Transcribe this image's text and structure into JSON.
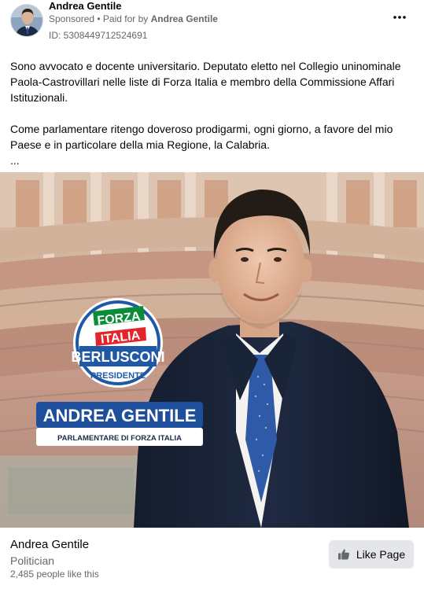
{
  "post": {
    "page_name": "Andrea Gentile",
    "sponsored_label": "Sponsored",
    "separator": " • ",
    "paid_for_prefix": "Paid for by ",
    "paid_for_name": "Andrea Gentile",
    "ad_id": "ID: 5308449712524691",
    "more_icon": "more-options-icon",
    "text_paragraph_1": "Sono avvocato e docente universitario. Deputato eletto nel Collegio uninominale Paola-Castrovillari nelle liste di Forza Italia e membro della Commissione Affari Istituzionali.",
    "text_paragraph_2": "Come parlamentare ritengo doveroso prodigarmi, ogni giorno, a favore del mio Paese e in particolare della mia Regione, la Calabria.",
    "ellipsis": "..."
  },
  "creative": {
    "logo_line_1": "FORZA",
    "logo_line_2": "ITALIA",
    "logo_line_3": "BERLUSCONI",
    "logo_line_4": "PRESIDENTE",
    "banner_name": "ANDREA GENTILE",
    "banner_subtitle": "PARLAMENTARE DI FORZA ITALIA",
    "colors": {
      "banner_blue": "#1d4f9c",
      "logo_green": "#0a8d3a",
      "logo_red": "#e3242b",
      "logo_blue": "#1f58a5"
    }
  },
  "footer": {
    "page_name": "Andrea Gentile",
    "category": "Politician",
    "likes": "2,485 people like this",
    "like_button_label": "Like Page",
    "like_icon": "thumbs-up-icon"
  }
}
